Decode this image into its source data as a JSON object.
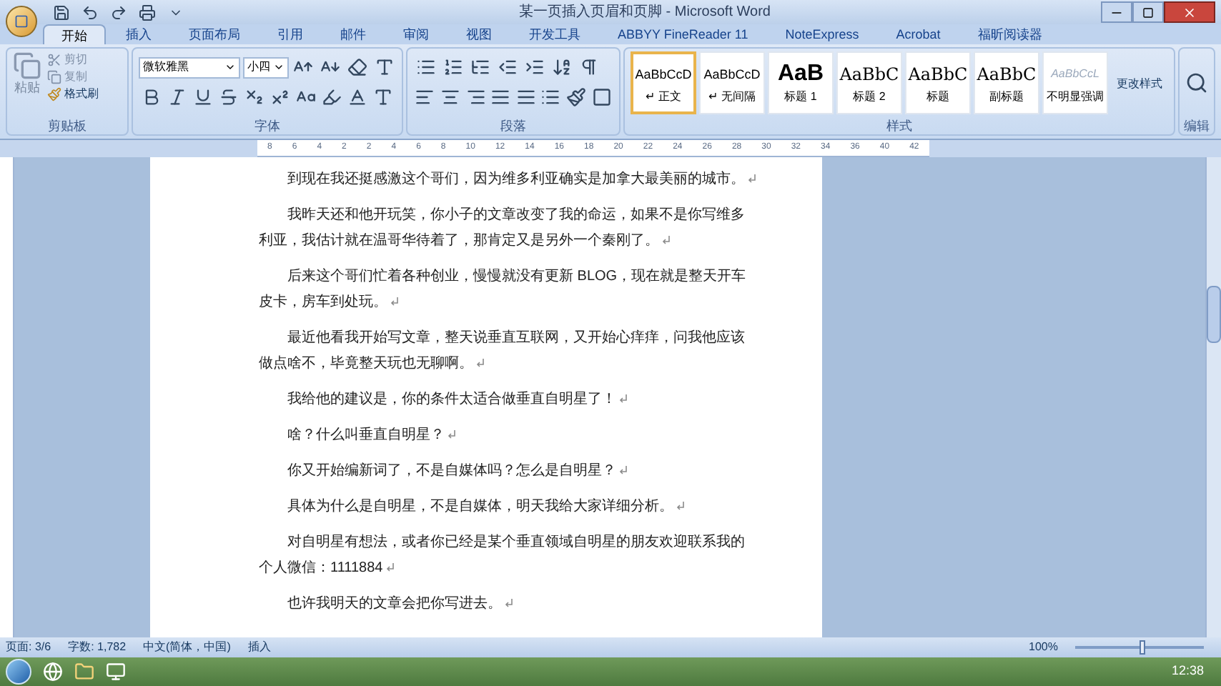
{
  "window": {
    "title": "某一页插入页眉和页脚 - Microsoft Word"
  },
  "tabs": [
    {
      "label": "开始",
      "selected": true
    },
    {
      "label": "插入",
      "selected": false
    },
    {
      "label": "页面布局",
      "selected": false
    },
    {
      "label": "引用",
      "selected": false
    },
    {
      "label": "邮件",
      "selected": false
    },
    {
      "label": "审阅",
      "selected": false
    },
    {
      "label": "视图",
      "selected": false
    },
    {
      "label": "开发工具",
      "selected": false
    },
    {
      "label": "ABBYY FineReader 11",
      "selected": false
    },
    {
      "label": "NoteExpress",
      "selected": false
    },
    {
      "label": "Acrobat",
      "selected": false
    },
    {
      "label": "福昕阅读器",
      "selected": false
    }
  ],
  "clipboard": {
    "paste": "粘贴",
    "cut": "剪切",
    "copy": "复制",
    "format_painter": "格式刷",
    "group_label": "剪贴板"
  },
  "font": {
    "font_name": "微软雅黑",
    "font_size": "小四",
    "group_label": "字体"
  },
  "paragraph": {
    "group_label": "段落"
  },
  "styles": {
    "items": [
      {
        "preview": "AaBbCcD",
        "name": "↵ 正文",
        "kind": "normal",
        "selected": true
      },
      {
        "preview": "AaBbCcD",
        "name": "↵ 无间隔",
        "kind": "normal",
        "selected": false
      },
      {
        "preview": "AaB",
        "name": "标题 1",
        "kind": "big",
        "selected": false
      },
      {
        "preview": "AaBbC",
        "name": "标题 2",
        "kind": "heading",
        "selected": false
      },
      {
        "preview": "AaBbC",
        "name": "标题",
        "kind": "heading",
        "selected": false
      },
      {
        "preview": "AaBbC",
        "name": "副标题",
        "kind": "heading",
        "selected": false
      },
      {
        "preview": "AaBbCcL",
        "name": "不明显强调",
        "kind": "faint",
        "selected": false
      }
    ],
    "change_styles": "更改样式",
    "group_label": "样式"
  },
  "editing": {
    "group_label": "编辑"
  },
  "ruler": {
    "marks": [
      "8",
      "6",
      "4",
      "2",
      "2",
      "4",
      "6",
      "8",
      "10",
      "12",
      "14",
      "16",
      "18",
      "20",
      "22",
      "24",
      "26",
      "28",
      "30",
      "32",
      "34",
      "36",
      "40",
      "42"
    ]
  },
  "document": {
    "paragraphs": [
      "到现在我还挺感激这个哥们，因为维多利亚确实是加拿大最美丽的城市。",
      "我昨天还和他开玩笑，你小子的文章改变了我的命运，如果不是你写维多利亚，我估计就在温哥华待着了，那肯定又是另外一个秦刚了。",
      "后来这个哥们忙着各种创业，慢慢就没有更新 BLOG，现在就是整天开车皮卡，房车到处玩。",
      "最近他看我开始写文章，整天说垂直互联网，又开始心痒痒，问我他应该做点啥不，毕竟整天玩也无聊啊。",
      "我给他的建议是，你的条件太适合做垂直自明星了！",
      "啥？什么叫垂直自明星？",
      "你又开始编新词了，不是自媒体吗？怎么是自明星？",
      "具体为什么是自明星，不是自媒体，明天我给大家详细分析。",
      "对自明星有想法，或者你已经是某个垂直领域自明星的朋友欢迎联系我的个人微信：1111884",
      "也许我明天的文章会把你写进去。"
    ]
  },
  "status_bar": {
    "items": [
      "页面: 3/6",
      "字数: 1,782",
      "中文(简体，中国)",
      "插入"
    ],
    "zoom": "100%",
    "zoom_level": {
      "level": 0.5
    }
  },
  "taskbar": {
    "clock": "12:38"
  }
}
